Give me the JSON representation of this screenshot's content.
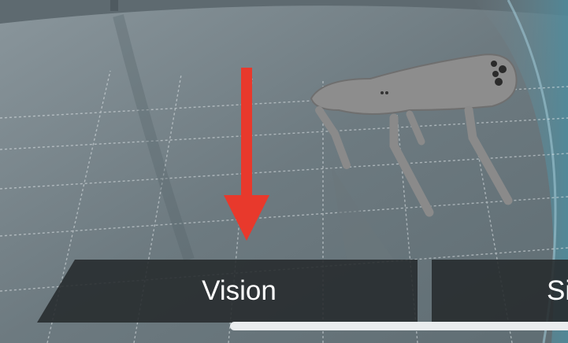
{
  "carousel": {
    "tabs": [
      {
        "label": "Vision",
        "selected": true
      },
      {
        "label": "Si",
        "selected": false
      }
    ]
  },
  "annotation": {
    "color": "#e8392c",
    "icon": "arrow-down-icon"
  },
  "scene": {
    "subject": "robot-dog-icon"
  }
}
